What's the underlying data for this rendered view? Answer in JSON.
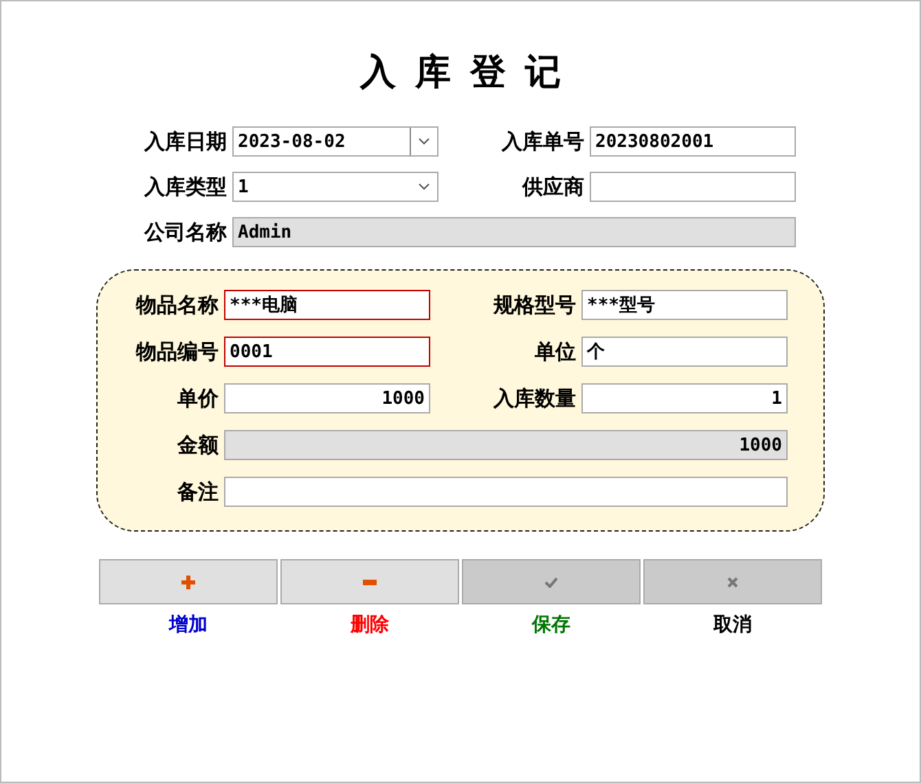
{
  "title": "入库登记",
  "header_rows": [
    [
      {
        "label": "入库日期",
        "value": "2023-08-02",
        "kind": "date"
      },
      {
        "label": "入库单号",
        "value": "20230802001",
        "kind": "text"
      }
    ],
    [
      {
        "label": "入库类型",
        "value": "1",
        "kind": "select"
      },
      {
        "label": "供应商",
        "kind": "text"
      }
    ],
    [
      {
        "label": "公司名称",
        "value": "Admin",
        "kind": "text",
        "wide": true,
        "readonly": true
      }
    ]
  ],
  "item_rows": [
    [
      {
        "label": "物品名称",
        "value": "***电脑",
        "kind": "text",
        "required": true
      },
      {
        "label": "规格型号",
        "value": "***型号",
        "kind": "text"
      }
    ],
    [
      {
        "label": "物品编号",
        "value": "0001",
        "kind": "text",
        "required": true
      },
      {
        "label": "单位",
        "value": "个",
        "kind": "text"
      }
    ],
    [
      {
        "label": "单价",
        "value": "1000",
        "kind": "number"
      },
      {
        "label": "入库数量",
        "value": "1",
        "kind": "number"
      }
    ],
    [
      {
        "label": "金额",
        "value": "1000",
        "kind": "number",
        "wide": true,
        "readonly": true
      }
    ],
    [
      {
        "label": "备注",
        "kind": "text",
        "wide": true
      }
    ]
  ],
  "buttons": [
    {
      "label": "增加",
      "color": "#0000cc",
      "disabled": false
    },
    {
      "label": "删除",
      "color": "#ff0000",
      "disabled": false
    },
    {
      "label": "保存",
      "color": "#007700",
      "disabled": true
    },
    {
      "label": "取消",
      "color": "#000000",
      "disabled": true
    }
  ]
}
